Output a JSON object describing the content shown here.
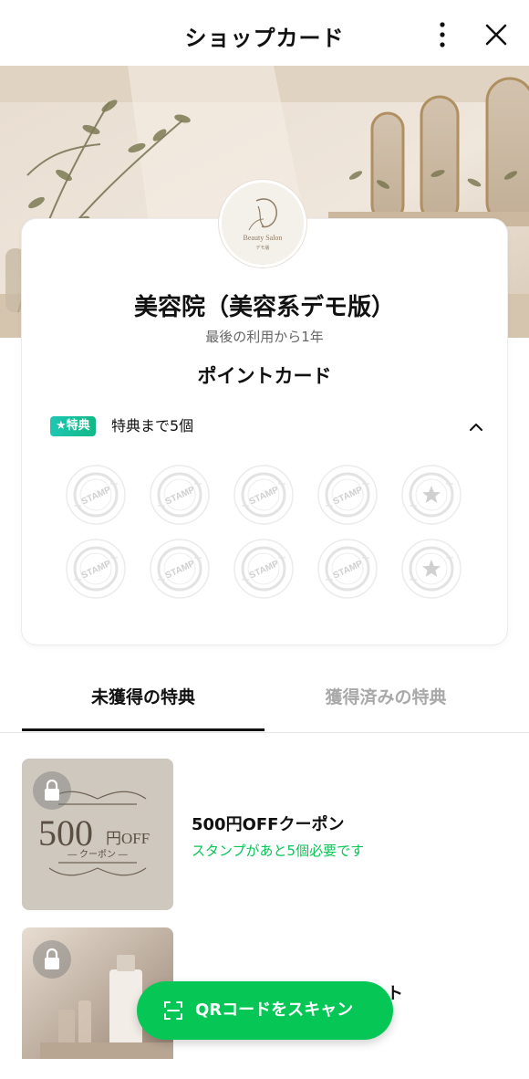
{
  "header": {
    "title": "ショップカード",
    "more_icon": "more-vertical-icon",
    "close_icon": "close-icon"
  },
  "shop": {
    "name": "美容院（美容系デモ版）",
    "last_used": "最後の利用から1年",
    "logo_text": "Beauty Salon",
    "logo_subtext": "デモ版"
  },
  "card": {
    "type": "ポイントカード",
    "benefit_badge": "★特典",
    "benefit_text": "特典まで5個",
    "stamp_label": "STAMP",
    "stamps_total": 10,
    "stamps_collected": 0
  },
  "tabs": [
    {
      "label": "未獲得の特典",
      "active": true
    },
    {
      "label": "獲得済みの特典",
      "active": false
    }
  ],
  "rewards": [
    {
      "title": "500円OFFクーポン",
      "subtitle": "スタンプがあと5個必要です",
      "thumb_main": "500",
      "thumb_unit": "円OFF",
      "thumb_sub": "― クーポン ―",
      "locked": true
    },
    {
      "title_fragment": "ト",
      "locked": true
    }
  ],
  "scan_button": {
    "label": "QRコードをスキャン",
    "icon": "scan-frame-icon"
  },
  "colors": {
    "accent_green": "#06c755",
    "badge_teal": "#12b886",
    "inactive_tab": "#a9a9a9"
  }
}
